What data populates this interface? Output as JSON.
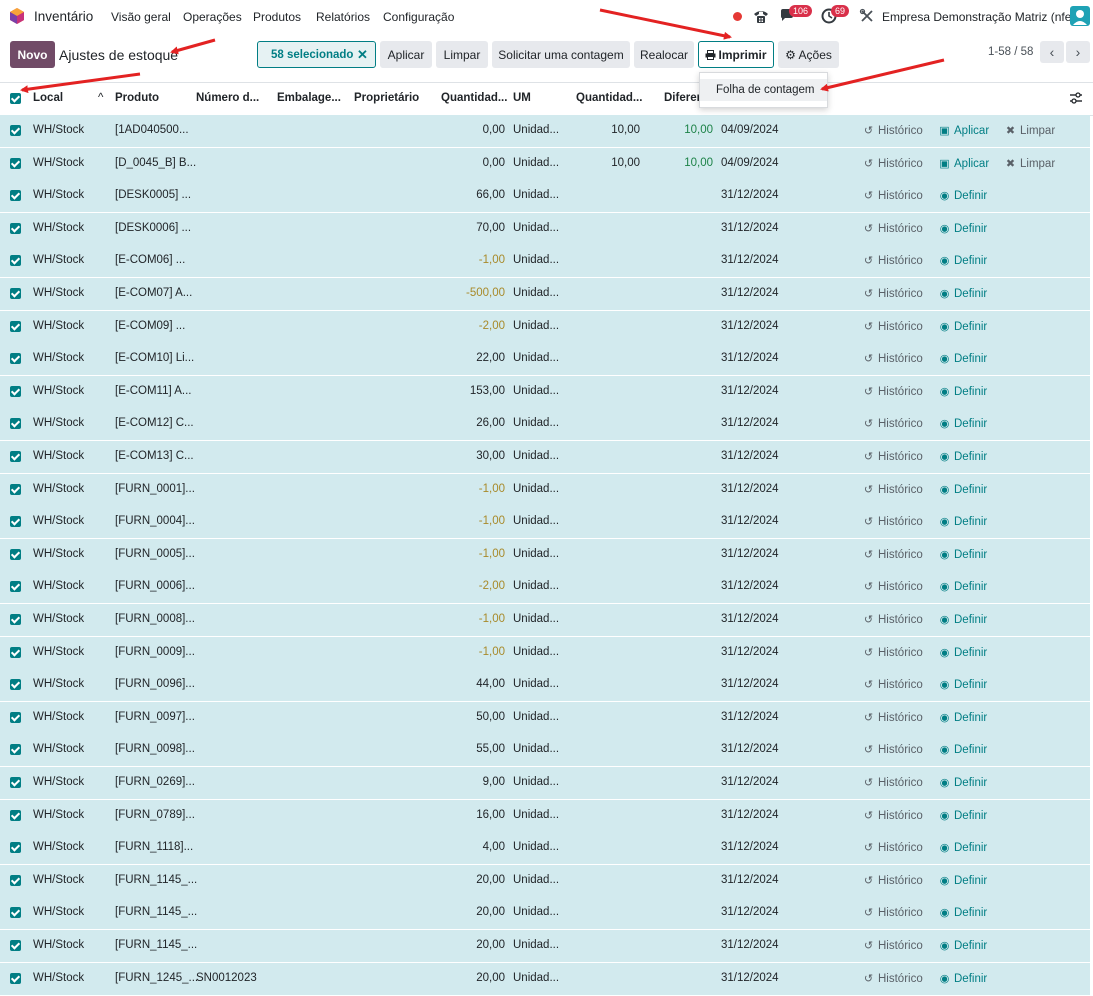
{
  "navbar": {
    "app_title": "Inventário",
    "menu": [
      "Visão geral",
      "Operações",
      "Produtos",
      "Relatórios",
      "Configuração"
    ],
    "badge_chat": "106",
    "badge_activity": "69",
    "company": "Empresa Demonstração Matriz (nfe)"
  },
  "control": {
    "new_label": "Novo",
    "breadcrumb": "Ajustes de estoque",
    "selected_label": "58 selecionado",
    "buttons": {
      "apply": "Aplicar",
      "clear": "Limpar",
      "request_count": "Solicitar uma contagem",
      "relocate": "Realocar",
      "print": "Imprimir",
      "actions": "Ações"
    },
    "pager": "1-58 / 58"
  },
  "dropdown": {
    "item": "Folha de contagem"
  },
  "table": {
    "headers": [
      "Local",
      "Produto",
      "Número d...",
      "Embalage...",
      "Proprietário",
      "Quantidad...",
      "UM",
      "Quantidad...",
      "Diferer"
    ],
    "actions": {
      "history": "Histórico",
      "apply": "Aplicar",
      "clear": "Limpar",
      "set": "Definir"
    },
    "rows": [
      {
        "local": "WH/Stock",
        "produto": "[1AD040500...",
        "qty": "0,00",
        "um": "Unidad...",
        "counted": "10,00",
        "diff": "10,00",
        "date": "04/09/2024",
        "mode": "apply"
      },
      {
        "local": "WH/Stock",
        "produto": "[D_0045_B] B...",
        "qty": "0,00",
        "um": "Unidad...",
        "counted": "10,00",
        "diff": "10,00",
        "date": "04/09/2024",
        "mode": "apply"
      },
      {
        "local": "WH/Stock",
        "produto": "[DESK0005] ...",
        "qty": "66,00",
        "um": "Unidad...",
        "counted": "",
        "diff": "",
        "date": "31/12/2024",
        "mode": "set"
      },
      {
        "local": "WH/Stock",
        "produto": "[DESK0006] ...",
        "qty": "70,00",
        "um": "Unidad...",
        "counted": "",
        "diff": "",
        "date": "31/12/2024",
        "mode": "set"
      },
      {
        "local": "WH/Stock",
        "produto": "[E-COM06] ...",
        "qty": "-1,00",
        "um": "Unidad...",
        "counted": "",
        "diff": "",
        "date": "31/12/2024",
        "mode": "set"
      },
      {
        "local": "WH/Stock",
        "produto": "[E-COM07] A...",
        "qty": "-500,00",
        "um": "Unidad...",
        "counted": "",
        "diff": "",
        "date": "31/12/2024",
        "mode": "set"
      },
      {
        "local": "WH/Stock",
        "produto": "[E-COM09] ...",
        "qty": "-2,00",
        "um": "Unidad...",
        "counted": "",
        "diff": "",
        "date": "31/12/2024",
        "mode": "set"
      },
      {
        "local": "WH/Stock",
        "produto": "[E-COM10] Li...",
        "qty": "22,00",
        "um": "Unidad...",
        "counted": "",
        "diff": "",
        "date": "31/12/2024",
        "mode": "set"
      },
      {
        "local": "WH/Stock",
        "produto": "[E-COM11] A...",
        "qty": "153,00",
        "um": "Unidad...",
        "counted": "",
        "diff": "",
        "date": "31/12/2024",
        "mode": "set"
      },
      {
        "local": "WH/Stock",
        "produto": "[E-COM12] C...",
        "qty": "26,00",
        "um": "Unidad...",
        "counted": "",
        "diff": "",
        "date": "31/12/2024",
        "mode": "set"
      },
      {
        "local": "WH/Stock",
        "produto": "[E-COM13] C...",
        "qty": "30,00",
        "um": "Unidad...",
        "counted": "",
        "diff": "",
        "date": "31/12/2024",
        "mode": "set"
      },
      {
        "local": "WH/Stock",
        "produto": "[FURN_0001]...",
        "qty": "-1,00",
        "um": "Unidad...",
        "counted": "",
        "diff": "",
        "date": "31/12/2024",
        "mode": "set"
      },
      {
        "local": "WH/Stock",
        "produto": "[FURN_0004]...",
        "qty": "-1,00",
        "um": "Unidad...",
        "counted": "",
        "diff": "",
        "date": "31/12/2024",
        "mode": "set"
      },
      {
        "local": "WH/Stock",
        "produto": "[FURN_0005]...",
        "qty": "-1,00",
        "um": "Unidad...",
        "counted": "",
        "diff": "",
        "date": "31/12/2024",
        "mode": "set"
      },
      {
        "local": "WH/Stock",
        "produto": "[FURN_0006]...",
        "qty": "-2,00",
        "um": "Unidad...",
        "counted": "",
        "diff": "",
        "date": "31/12/2024",
        "mode": "set"
      },
      {
        "local": "WH/Stock",
        "produto": "[FURN_0008]...",
        "qty": "-1,00",
        "um": "Unidad...",
        "counted": "",
        "diff": "",
        "date": "31/12/2024",
        "mode": "set"
      },
      {
        "local": "WH/Stock",
        "produto": "[FURN_0009]...",
        "qty": "-1,00",
        "um": "Unidad...",
        "counted": "",
        "diff": "",
        "date": "31/12/2024",
        "mode": "set"
      },
      {
        "local": "WH/Stock",
        "produto": "[FURN_0096]...",
        "qty": "44,00",
        "um": "Unidad...",
        "counted": "",
        "diff": "",
        "date": "31/12/2024",
        "mode": "set"
      },
      {
        "local": "WH/Stock",
        "produto": "[FURN_0097]...",
        "qty": "50,00",
        "um": "Unidad...",
        "counted": "",
        "diff": "",
        "date": "31/12/2024",
        "mode": "set"
      },
      {
        "local": "WH/Stock",
        "produto": "[FURN_0098]...",
        "qty": "55,00",
        "um": "Unidad...",
        "counted": "",
        "diff": "",
        "date": "31/12/2024",
        "mode": "set"
      },
      {
        "local": "WH/Stock",
        "produto": "[FURN_0269]...",
        "qty": "9,00",
        "um": "Unidad...",
        "counted": "",
        "diff": "",
        "date": "31/12/2024",
        "mode": "set"
      },
      {
        "local": "WH/Stock",
        "produto": "[FURN_0789]...",
        "qty": "16,00",
        "um": "Unidad...",
        "counted": "",
        "diff": "",
        "date": "31/12/2024",
        "mode": "set"
      },
      {
        "local": "WH/Stock",
        "produto": "[FURN_1118]...",
        "qty": "4,00",
        "um": "Unidad...",
        "counted": "",
        "diff": "",
        "date": "31/12/2024",
        "mode": "set"
      },
      {
        "local": "WH/Stock",
        "produto": "[FURN_1145_...",
        "qty": "20,00",
        "um": "Unidad...",
        "counted": "",
        "diff": "",
        "date": "31/12/2024",
        "mode": "set"
      },
      {
        "local": "WH/Stock",
        "produto": "[FURN_1145_...",
        "qty": "20,00",
        "um": "Unidad...",
        "counted": "",
        "diff": "",
        "date": "31/12/2024",
        "mode": "set"
      },
      {
        "local": "WH/Stock",
        "produto": "[FURN_1145_...",
        "qty": "20,00",
        "um": "Unidad...",
        "counted": "",
        "diff": "",
        "date": "31/12/2024",
        "mode": "set"
      },
      {
        "local": "WH/Stock",
        "produto": "[FURN_1245_...",
        "serial": "SN0012023",
        "qty": "20,00",
        "um": "Unidad...",
        "counted": "",
        "diff": "",
        "date": "31/12/2024",
        "mode": "set"
      }
    ]
  },
  "colors": {
    "brand": "#714b67",
    "accent": "#017e84",
    "row_selected": "#d2eaee",
    "badge": "#d9304a",
    "annotation_arrow": "#e32222"
  }
}
